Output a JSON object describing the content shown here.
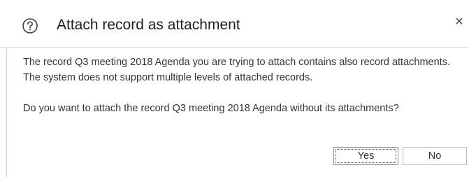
{
  "dialog": {
    "title": "Attach record as attachment",
    "help_icon": "question-circle-icon",
    "close_icon": "close-icon",
    "close_glyph": "×",
    "message": {
      "line1": "The record Q3 meeting 2018 Agenda you are trying to attach contains also record attachments.",
      "line2": "The system does not support multiple levels of attached records.",
      "line3": "Do you want to attach the record Q3 meeting 2018 Agenda without its attachments?"
    },
    "buttons": {
      "yes_label": "Yes",
      "no_label": "No"
    }
  }
}
